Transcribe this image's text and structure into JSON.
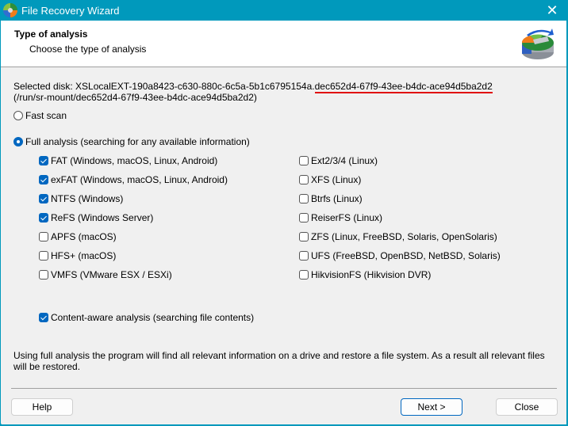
{
  "window": {
    "title": "File Recovery Wizard",
    "close_label": "✕"
  },
  "header": {
    "title": "Type of analysis",
    "subtitle": "Choose the type of analysis"
  },
  "disk": {
    "prefix": "Selected disk: XSLocalEXT-190a8423-c630-880c-6c5a-5b1c6795154a.",
    "uuid": "dec652d4-67f9-43ee-b4dc-ace94d5ba2d2",
    "path": "(/run/sr-mount/dec652d4-67f9-43ee-b4dc-ace94d5ba2d2)"
  },
  "scan_modes": [
    {
      "label": "Fast scan",
      "selected": false
    },
    {
      "label": "Full analysis (searching for any available information)",
      "selected": true
    }
  ],
  "filesystems_left": [
    {
      "label": "FAT (Windows, macOS, Linux, Android)",
      "checked": true
    },
    {
      "label": "exFAT (Windows, macOS, Linux, Android)",
      "checked": true
    },
    {
      "label": "NTFS (Windows)",
      "checked": true
    },
    {
      "label": "ReFS (Windows Server)",
      "checked": true
    },
    {
      "label": "APFS (macOS)",
      "checked": false
    },
    {
      "label": "HFS+ (macOS)",
      "checked": false
    },
    {
      "label": "VMFS (VMware ESX / ESXi)",
      "checked": false
    }
  ],
  "filesystems_right": [
    {
      "label": "Ext2/3/4 (Linux)",
      "checked": false
    },
    {
      "label": "XFS (Linux)",
      "checked": false
    },
    {
      "label": "Btrfs (Linux)",
      "checked": false
    },
    {
      "label": "ReiserFS (Linux)",
      "checked": false
    },
    {
      "label": "ZFS (Linux, FreeBSD, Solaris, OpenSolaris)",
      "checked": false
    },
    {
      "label": "UFS (FreeBSD, OpenBSD, NetBSD, Solaris)",
      "checked": false
    },
    {
      "label": "HikvisionFS (Hikvision DVR)",
      "checked": false
    }
  ],
  "content_aware": {
    "label": "Content-aware analysis (searching file contents)",
    "checked": true
  },
  "info_text": "Using full analysis the program will find all relevant information on a drive and restore a file system. As a result all relevant files will be restored.",
  "buttons": {
    "help": "Help",
    "next": "Next >",
    "close": "Close"
  },
  "colors": {
    "titlebar": "#0099bc",
    "accent": "#0067c0",
    "underline": "#e01010"
  }
}
